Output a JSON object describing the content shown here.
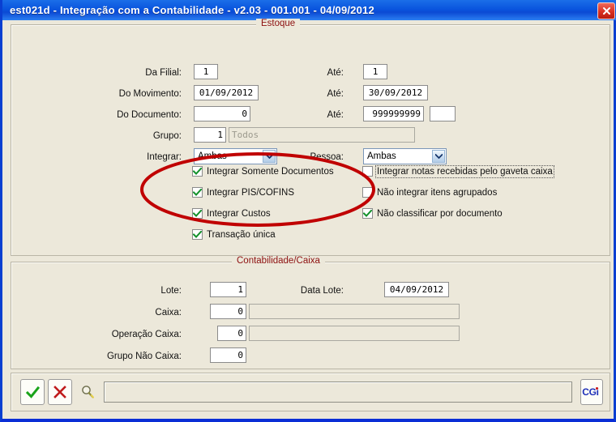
{
  "window": {
    "title": "est021d - Integração com a Contabilidade - v2.03 - 001.001 - 04/09/2012",
    "close_icon": "close-icon",
    "titlebar_color": "#0a55de",
    "body_color": "#ece8da",
    "caption_color": "#8d1010"
  },
  "estoque": {
    "caption": "Estoque",
    "fields": [
      {
        "label": "Da Filial:",
        "value": "1",
        "align": "ctr"
      },
      {
        "label": "Até:",
        "value": "1",
        "align": "ctr"
      },
      {
        "label": "Do Movimento:",
        "value": "01/09/2012",
        "align": "ctr"
      },
      {
        "label": "Até:",
        "value": "30/09/2012",
        "align": "ctr"
      },
      {
        "label": "Do Documento:",
        "value": "0",
        "align": "num"
      },
      {
        "label": "Até:",
        "value": "999999999",
        "align": "num"
      },
      {
        "label": "",
        "value": "",
        "align": "num"
      },
      {
        "label": "Grupo:",
        "value": "1",
        "align": "num"
      },
      {
        "label": "",
        "value": "Todos",
        "align": "left"
      }
    ],
    "integrar": {
      "label": "Integrar:",
      "value": "Ambas",
      "options": [
        "Ambas"
      ]
    },
    "pessoa": {
      "label": "Pessoa:",
      "value": "Ambas",
      "options": [
        "Ambas"
      ]
    },
    "checks_left": [
      {
        "label": "Integrar Somente Documentos",
        "checked": true
      },
      {
        "label": "Integrar PIS/COFINS",
        "checked": true
      },
      {
        "label": "Integrar Custos",
        "checked": true
      },
      {
        "label": "Transação única",
        "checked": true
      }
    ],
    "checks_right": [
      {
        "label": "Integrar notas recebidas pelo gaveta caixa",
        "checked": false,
        "focused": true
      },
      {
        "label": "Não integrar itens agrupados",
        "checked": false,
        "focused": false
      },
      {
        "label": "Não classificar por documento",
        "checked": true,
        "focused": false
      }
    ]
  },
  "contabilidade": {
    "caption": "Contabilidade/Caixa",
    "rows": [
      {
        "label": "Lote:",
        "value": "1",
        "align": "num"
      },
      {
        "label": "Data Lote:",
        "value": "04/09/2012",
        "align": "ctr"
      },
      {
        "label": "Caixa:",
        "value": "0",
        "align": "num"
      },
      {
        "label": "Operação Caixa:",
        "value": "0",
        "align": "num"
      },
      {
        "label": "Grupo Não Caixa:",
        "value": "0",
        "align": "num"
      }
    ],
    "desc_caixa": "",
    "desc_operacao": ""
  },
  "actions": {
    "confirm": {
      "name": "confirm-button",
      "icon": "check-icon",
      "color": "#19a319"
    },
    "cancel": {
      "name": "cancel-button",
      "icon": "x-icon",
      "color": "#c01b1b"
    },
    "search": {
      "name": "search-button",
      "icon": "magnifier-icon"
    },
    "status_text": "",
    "brand": "CGi",
    "brand_color": "#1d2fb8"
  },
  "annotation": {
    "shape": "ellipse",
    "color": "#c00000",
    "targets": [
      "Integrar Somente Documentos",
      "Integrar PIS/COFINS",
      "Integrar Custos"
    ]
  }
}
